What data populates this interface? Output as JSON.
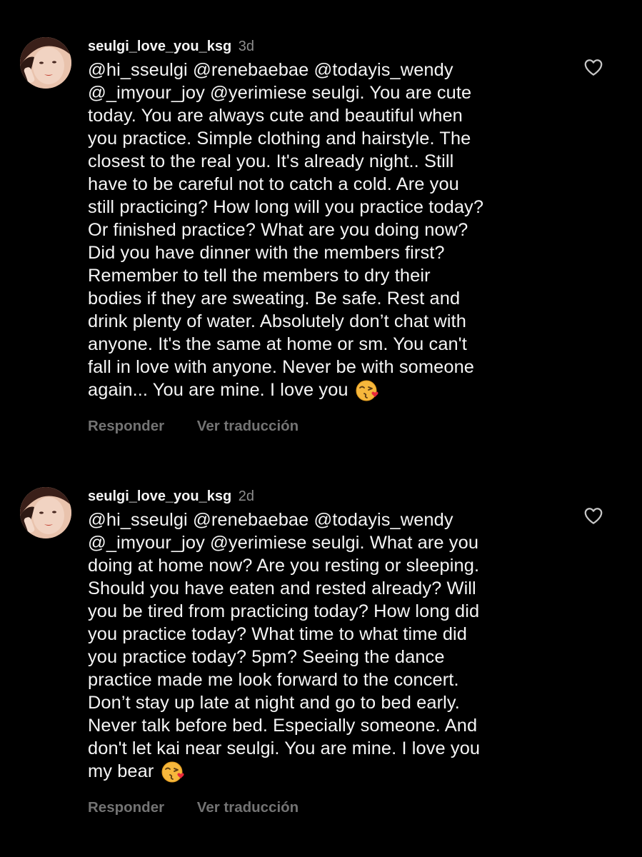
{
  "comments": [
    {
      "username": "seulgi_love_you_ksg",
      "time": "3d",
      "text": "@hi_sseulgi @renebaebae @todayis_wendy\n@_imyour_joy @yerimiese  seulgi. You are cute\ntoday. You are always cute and beautiful when\nyou practice. Simple clothing and hairstyle. The\nclosest to the real you. It's already night.. Still\nhave to be careful not to catch a cold. Are you\nstill practicing? How long will you practice today?\nOr finished practice? What are you doing now?\nDid you have dinner with the members first?\nRemember to tell the members to dry their\nbodies if they are sweating. Be safe. Rest and\ndrink plenty of water. Absolutely don’t chat with\nanyone. It's the same at home or sm. You can't\nfall in love with anyone. Never be with someone\nagain... You are mine. I love you ",
      "emoji": "face-blowing-kiss-icon",
      "reply_label": "Responder",
      "translate_label": "Ver traducción"
    },
    {
      "username": "seulgi_love_you_ksg",
      "time": "2d",
      "text": "@hi_sseulgi @renebaebae @todayis_wendy\n@_imyour_joy @yerimiese seulgi. What are you\ndoing at home now? Are you resting or sleeping.\nShould you have eaten and rested already? Will\nyou be tired from practicing today?  How long did\nyou practice today? What time to what time did\nyou practice today? 5pm? Seeing the dance\npractice made me look forward to the concert.\nDon’t stay up late at night and go to bed early.\nNever talk before bed. Especially someone. And\ndon't let kai near seulgi. You are mine. I love you\nmy bear ",
      "emoji": "face-blowing-kiss-icon",
      "reply_label": "Responder",
      "translate_label": "Ver traducción"
    }
  ],
  "colors": {
    "background": "#000000",
    "primary_text": "#f5f5f5",
    "secondary_text": "#8e8e8e",
    "action_text": "#737373"
  }
}
